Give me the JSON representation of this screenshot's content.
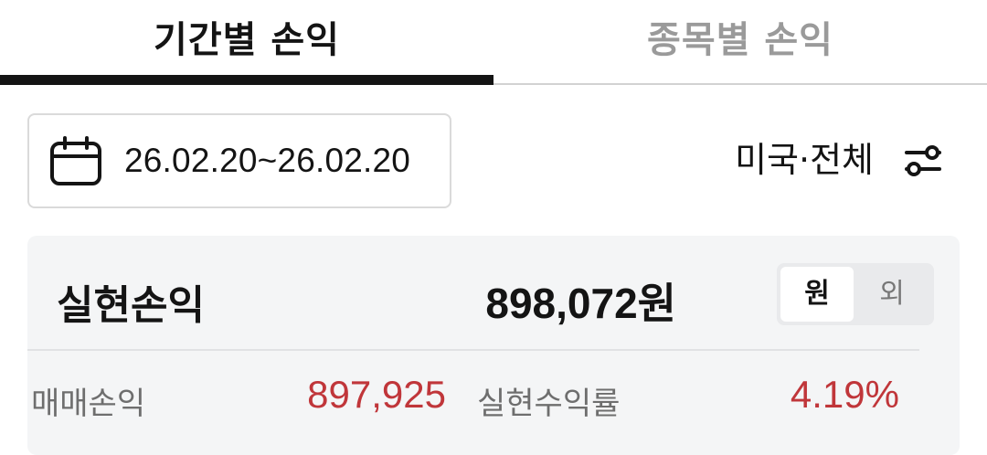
{
  "tabs": [
    {
      "label": "기간별 손익",
      "active": true
    },
    {
      "label": "종목별 손익",
      "active": false
    }
  ],
  "date_range": {
    "icon": "calendar-icon",
    "text": "26.02.20~26.02.20"
  },
  "filter": {
    "text": "미국·전체",
    "icon": "filter-sliders-icon"
  },
  "summary": {
    "realized_label": "실현손익",
    "realized_value": "898,072",
    "realized_unit": "원",
    "currency_toggle": {
      "options": [
        "원",
        "외"
      ],
      "selected": "원"
    },
    "trade_pnl_label": "매매손익",
    "trade_pnl_value": "897,925",
    "return_rate_label": "실현수익률",
    "return_rate_value": "4.19%"
  },
  "colors": {
    "text": "#141414",
    "inactive_tab": "#9a9a9a",
    "profit_red": "#c0363a",
    "card_bg": "#f4f5f6"
  }
}
